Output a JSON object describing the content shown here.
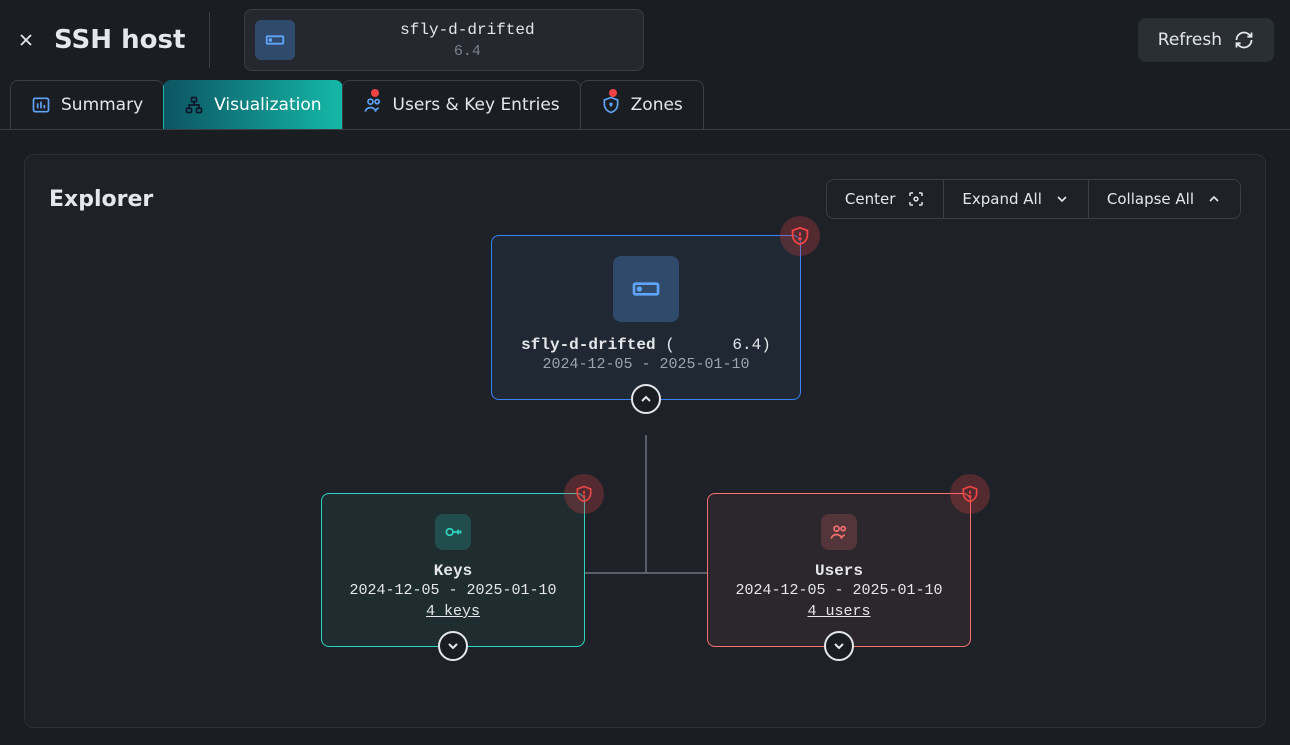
{
  "header": {
    "title": "SSH host",
    "host_name": "sfly-d-drifted",
    "host_version": "6.4",
    "refresh_label": "Refresh"
  },
  "tabs": {
    "summary": "Summary",
    "visualization": "Visualization",
    "users_keys": "Users & Key Entries",
    "zones": "Zones"
  },
  "panel": {
    "title": "Explorer",
    "toolbar": {
      "center": "Center",
      "expand": "Expand All",
      "collapse": "Collapse All"
    }
  },
  "graph": {
    "root": {
      "name": "sfly-d-drifted",
      "version": "6.4",
      "date_range": "2024-12-05 - 2025-01-10"
    },
    "keys": {
      "title": "Keys",
      "date_range": "2024-12-05 - 2025-01-10",
      "count_label": "4 keys"
    },
    "users": {
      "title": "Users",
      "date_range": "2024-12-05 - 2025-01-10",
      "count_label": "4 users"
    }
  }
}
